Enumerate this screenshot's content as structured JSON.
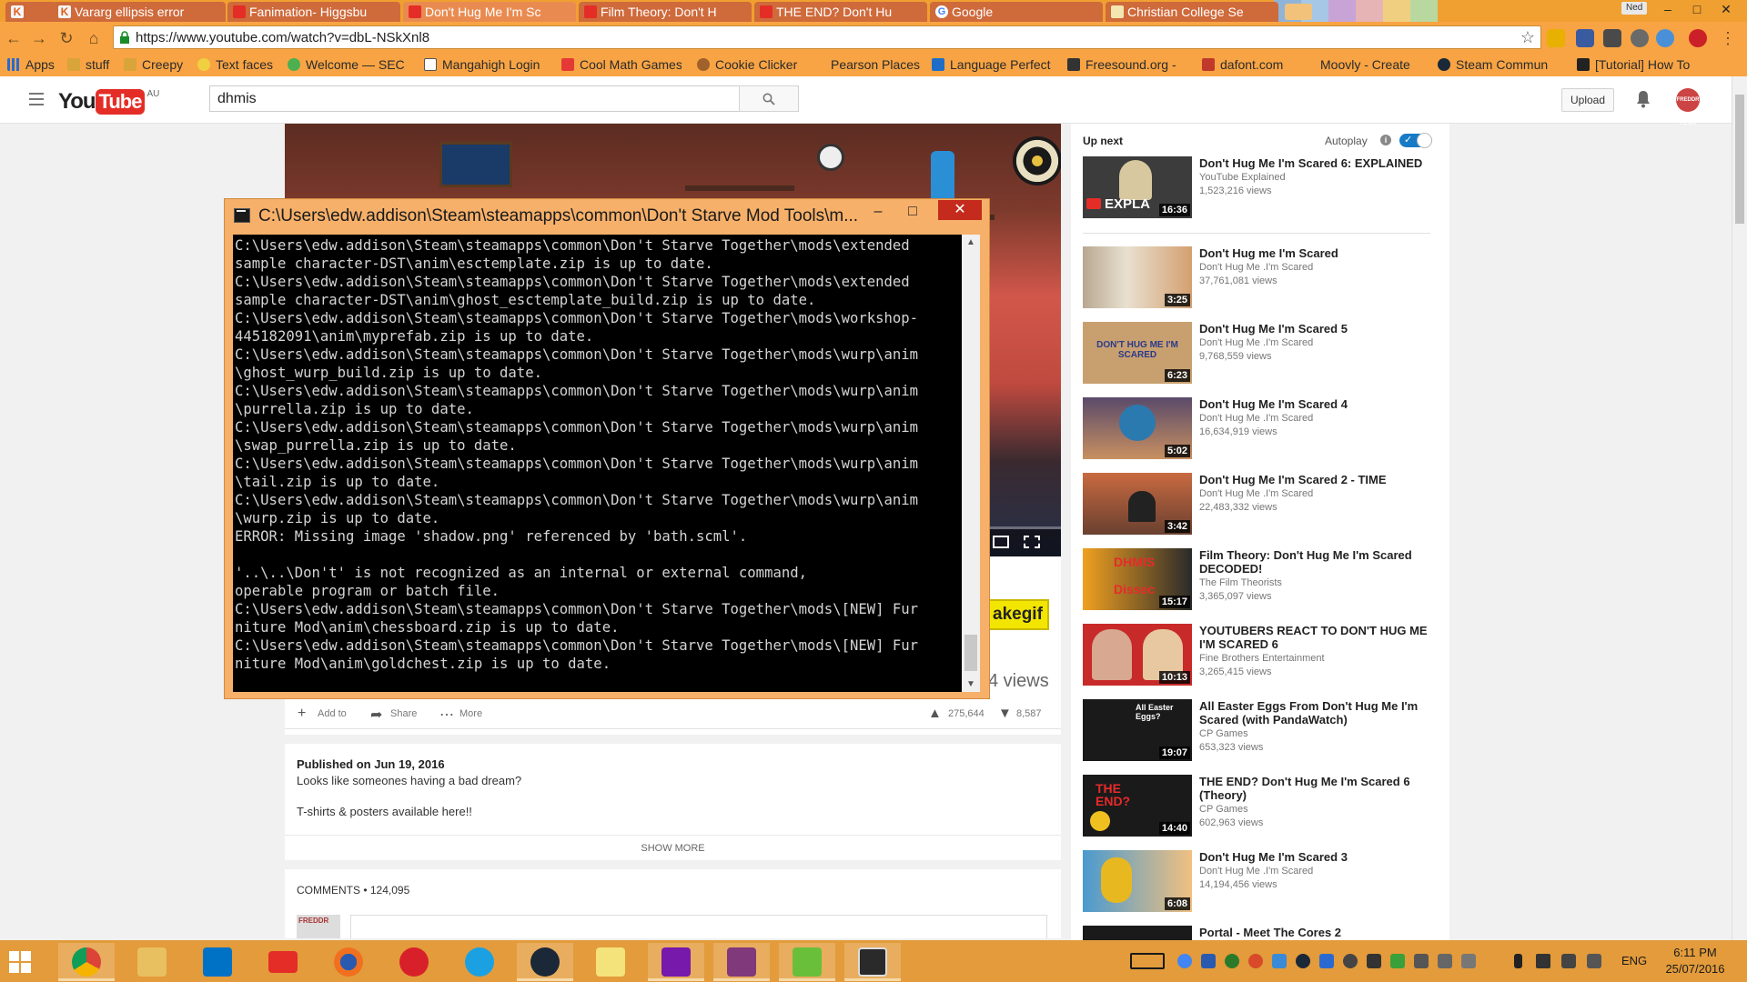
{
  "browser": {
    "tabs": [
      {
        "label": "",
        "favicon": "k-icon"
      },
      {
        "label": "Vararg ellipsis error",
        "favicon": "k-icon"
      },
      {
        "label": "Fanimation- Higgsbu",
        "favicon": "youtube-icon"
      },
      {
        "label": "Don't Hug Me I'm Sc",
        "favicon": "youtube-icon",
        "active": true
      },
      {
        "label": "Film Theory: Don't H",
        "favicon": "youtube-icon"
      },
      {
        "label": "THE END? Don't Hu",
        "favicon": "youtube-icon"
      },
      {
        "label": "Google",
        "favicon": "google-icon"
      },
      {
        "label": "Christian College Se",
        "favicon": "doc-icon"
      }
    ],
    "profile_name": "Ned",
    "url": "https://www.youtube.com/watch?v=dbL-NSkXnl8",
    "bookmarks": [
      {
        "label": "Apps",
        "icon": "apps-grid-icon"
      },
      {
        "label": "stuff",
        "icon": "folder-icon"
      },
      {
        "label": "Creepy",
        "icon": "folder-icon"
      },
      {
        "label": "Text faces",
        "icon": "smiley-icon"
      },
      {
        "label": "Welcome — SEC",
        "icon": "globe-icon"
      },
      {
        "label": "Mangahigh Login",
        "icon": "mangahigh-icon"
      },
      {
        "label": "Cool Math Games",
        "icon": "coolmath-icon"
      },
      {
        "label": "Cookie Clicker",
        "icon": "cookie-icon"
      },
      {
        "label": "Pearson Places",
        "icon": "pearson-icon"
      },
      {
        "label": "Language Perfect",
        "icon": "lp-icon"
      },
      {
        "label": "Freesound.org -",
        "icon": "freesound-icon"
      },
      {
        "label": "dafont.com",
        "icon": "dafont-icon"
      },
      {
        "label": "Moovly - Create",
        "icon": "moovly-icon"
      },
      {
        "label": "Steam Commun",
        "icon": "steam-icon"
      },
      {
        "label": "[Tutorial] How To",
        "icon": "tutorial-icon"
      }
    ]
  },
  "youtube": {
    "logo_you": "You",
    "logo_tube": "Tube",
    "country": "AU",
    "search_query": "dhmis",
    "upload_label": "Upload",
    "avatar_text": "FREDDR FILMS",
    "player": {
      "makegif_label": "akegif",
      "view_count": "4 views"
    },
    "actions": {
      "add_to": "Add to",
      "share": "Share",
      "more": "More",
      "likes": "275,644",
      "dislikes": "8,587"
    },
    "description": {
      "published": "Published on Jun 19, 2016",
      "line1": "Looks like someones having a bad dream?",
      "line2": "T-shirts & posters available here!!",
      "show_more": "SHOW MORE"
    },
    "comments_label": "COMMENTS • 124,095",
    "comment_avatar_text": "FREDDR",
    "up_next": {
      "label": "Up next",
      "autoplay_label": "Autoplay",
      "autoplay_on": true,
      "videos": [
        {
          "title": "Don't Hug Me I'm Scared 6: EXPLAINED",
          "channel": "YouTube Explained",
          "views": "1,523,216 views",
          "duration": "16:36",
          "thumb_text": "EXPLA"
        },
        {
          "title": "Don't Hug me I'm Scared",
          "channel": "Don't Hug Me .I'm Scared",
          "views": "37,761,081 views",
          "duration": "3:25",
          "thumb_text": ""
        },
        {
          "title": "Don't Hug Me I'm Scared 5",
          "channel": "Don't Hug Me .I'm Scared",
          "views": "9,768,559 views",
          "duration": "6:23",
          "thumb_text": "DON'T HUG ME I'M SCARED"
        },
        {
          "title": "Don't Hug Me I'm Scared 4",
          "channel": "Don't Hug Me .I'm Scared",
          "views": "16,634,919 views",
          "duration": "5:02",
          "thumb_text": ""
        },
        {
          "title": "Don't Hug Me I'm Scared 2 - TIME",
          "channel": "Don't Hug Me .I'm Scared",
          "views": "22,483,332 views",
          "duration": "3:42",
          "thumb_text": ""
        },
        {
          "title": "Film Theory: Don't Hug Me I'm Scared DECODED!",
          "channel": "The Film Theorists",
          "views": "3,365,097 views",
          "duration": "15:17",
          "thumb_text": "DHMIS Dissec"
        },
        {
          "title": "YOUTUBERS REACT TO DON'T HUG ME I'M SCARED 6",
          "channel": "Fine Brothers Entertainment",
          "views": "3,265,415 views",
          "duration": "10:13",
          "thumb_text": ""
        },
        {
          "title": "All Easter Eggs From Don't Hug Me I'm Scared (with PandaWatch)",
          "channel": "CP Games",
          "views": "653,323 views",
          "duration": "19:07",
          "thumb_text": "All Easter Eggs?"
        },
        {
          "title": "THE END? Don't Hug Me I'm Scared 6 (Theory)",
          "channel": "CP Games",
          "views": "602,963 views",
          "duration": "14:40",
          "thumb_text": "THE END?"
        },
        {
          "title": "Don't Hug Me I'm Scared 3",
          "channel": "Don't Hug Me .I'm Scared",
          "views": "14,194,456 views",
          "duration": "6:08",
          "thumb_text": ""
        },
        {
          "title": "Portal - Meet The Cores 2",
          "channel": "",
          "views": "",
          "duration": "",
          "thumb_text": ""
        }
      ]
    }
  },
  "console": {
    "title": "C:\\Users\\edw.addison\\Steam\\steamapps\\common\\Don't Starve Mod Tools\\m...",
    "lines": [
      "C:\\Users\\edw.addison\\Steam\\steamapps\\common\\Don't Starve Together\\mods\\extended",
      "sample character-DST\\anim\\esctemplate.zip is up to date.",
      "C:\\Users\\edw.addison\\Steam\\steamapps\\common\\Don't Starve Together\\mods\\extended",
      "sample character-DST\\anim\\ghost_esctemplate_build.zip is up to date.",
      "C:\\Users\\edw.addison\\Steam\\steamapps\\common\\Don't Starve Together\\mods\\workshop-",
      "445182091\\anim\\myprefab.zip is up to date.",
      "C:\\Users\\edw.addison\\Steam\\steamapps\\common\\Don't Starve Together\\mods\\wurp\\anim",
      "\\ghost_wurp_build.zip is up to date.",
      "C:\\Users\\edw.addison\\Steam\\steamapps\\common\\Don't Starve Together\\mods\\wurp\\anim",
      "\\purrella.zip is up to date.",
      "C:\\Users\\edw.addison\\Steam\\steamapps\\common\\Don't Starve Together\\mods\\wurp\\anim",
      "\\swap_purrella.zip is up to date.",
      "C:\\Users\\edw.addison\\Steam\\steamapps\\common\\Don't Starve Together\\mods\\wurp\\anim",
      "\\tail.zip is up to date.",
      "C:\\Users\\edw.addison\\Steam\\steamapps\\common\\Don't Starve Together\\mods\\wurp\\anim",
      "\\wurp.zip is up to date.",
      "ERROR: Missing image 'shadow.png' referenced by 'bath.scml'.",
      "",
      "'..\\..\\Don't' is not recognized as an internal or external command,",
      "operable program or batch file.",
      "C:\\Users\\edw.addison\\Steam\\steamapps\\common\\Don't Starve Together\\mods\\[NEW] Fur",
      "niture Mod\\anim\\chessboard.zip is up to date.",
      "C:\\Users\\edw.addison\\Steam\\steamapps\\common\\Don't Starve Together\\mods\\[NEW] Fur",
      "niture Mod\\anim\\goldchest.zip is up to date."
    ]
  },
  "taskbar": {
    "apps": [
      "chrome-icon",
      "file-explorer-icon",
      "outlook-icon",
      "youtube-app-icon",
      "firefox-icon",
      "pinwheel-app-icon",
      "internet-explorer-icon",
      "steam-icon",
      "sticky-notes-icon",
      "onenote-icon",
      "onenote-2013-icon",
      "game-app-icon",
      "console-window-icon"
    ],
    "language": "ENG",
    "time": "6:11 PM",
    "date": "25/07/2016"
  },
  "colors": {
    "chrome_accent": "#f8a444",
    "youtube_red": "#e52d27",
    "autoplay_blue": "#167ac6",
    "console_frame": "#f6b06a",
    "taskbar": "#e39b3b"
  }
}
